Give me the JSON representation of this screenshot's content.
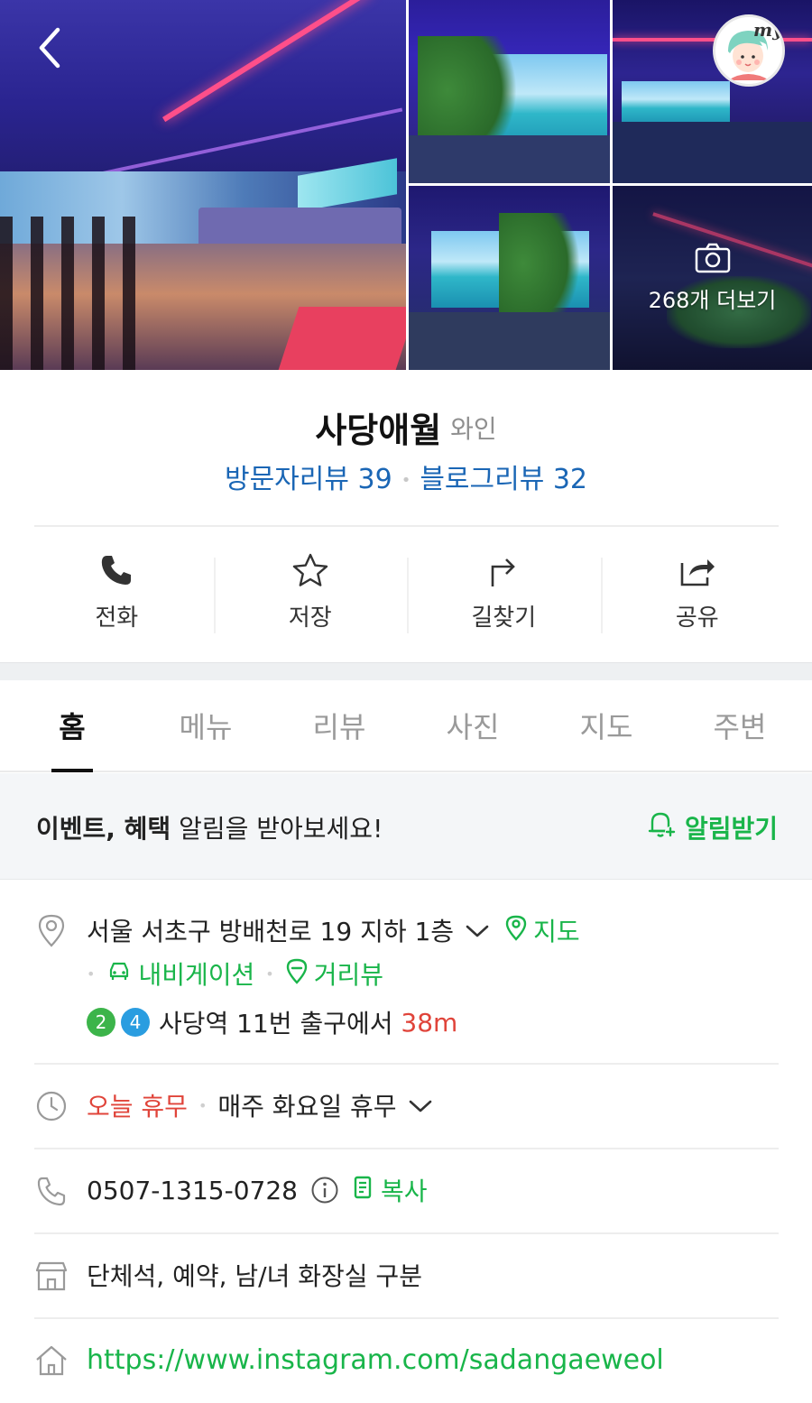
{
  "colors": {
    "accent_green": "#19b54a",
    "link_blue": "#1a66b5",
    "alert_red": "#e0443a",
    "line2_green": "#3cb44a",
    "line4_blue": "#2a9de0"
  },
  "header": {
    "back_icon": "chevron-left-icon",
    "profile_badge": "my"
  },
  "photos": {
    "more_label": "268개 더보기",
    "more_icon": "camera-icon"
  },
  "place": {
    "name": "사당애월",
    "category": "와인",
    "visitor_reviews": "방문자리뷰 39",
    "blog_reviews": "블로그리뷰 32"
  },
  "actions": [
    {
      "label": "전화",
      "icon": "phone-icon"
    },
    {
      "label": "저장",
      "icon": "star-icon"
    },
    {
      "label": "길찾기",
      "icon": "directions-icon"
    },
    {
      "label": "공유",
      "icon": "share-icon"
    }
  ],
  "tabs": [
    {
      "label": "홈",
      "active": true
    },
    {
      "label": "메뉴",
      "active": false
    },
    {
      "label": "리뷰",
      "active": false
    },
    {
      "label": "사진",
      "active": false
    },
    {
      "label": "지도",
      "active": false
    },
    {
      "label": "주변",
      "active": false
    }
  ],
  "notice": {
    "bold_text": "이벤트, 혜택",
    "text": " 알림을 받아보세요!",
    "button": "알림받기"
  },
  "address": {
    "text": "서울 서초구 방배천로 19 지하 1층",
    "map_link": "지도",
    "navigation_link": "내비게이션",
    "street_view_link": "거리뷰",
    "subway_line_1": "2",
    "subway_line_2": "4",
    "station": "사당역",
    "exit_text": " 11번 출구에서 ",
    "distance": "38m"
  },
  "hours": {
    "status": "오늘 휴무",
    "schedule": "매주 화요일 휴무"
  },
  "phone": {
    "number": "0507-1315-0728",
    "copy_label": "복사"
  },
  "amenities": {
    "text": "단체석, 예약, 남/녀 화장실 구분"
  },
  "website": {
    "url": "https://www.instagram.com/sadangaeweol"
  }
}
